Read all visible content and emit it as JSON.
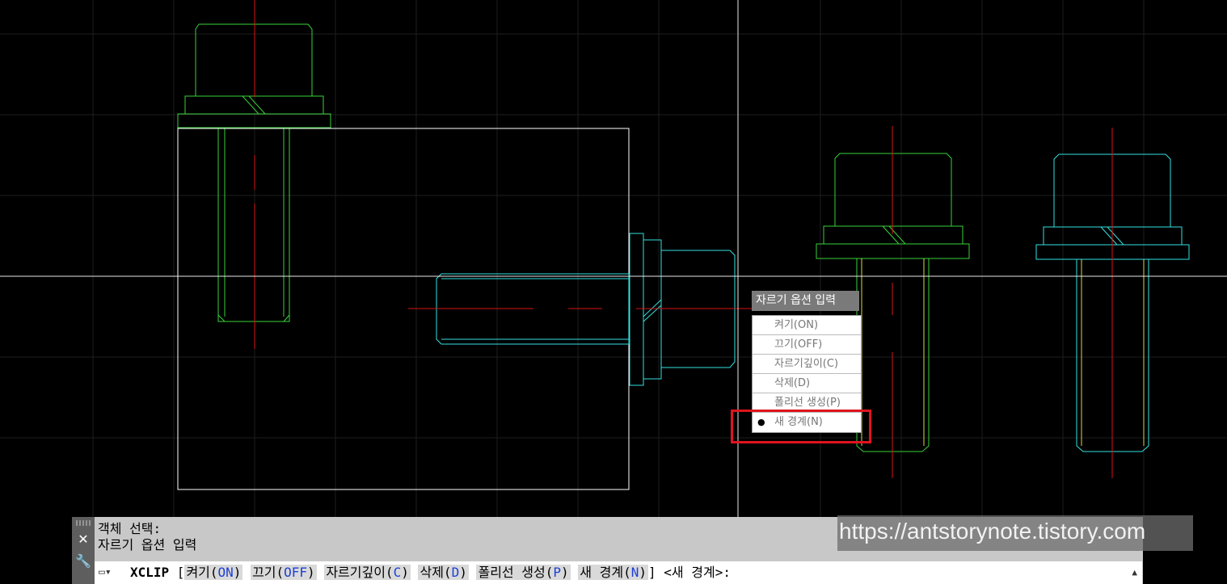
{
  "menu": {
    "title": "자르기 옵션 입력",
    "items": [
      "켜기(ON)",
      "끄기(OFF)",
      "자르기깊이(C)",
      "삭제(D)",
      "폴리선 생성(P)",
      "새 경계(N)"
    ],
    "selected_index": 5,
    "bullet": "●"
  },
  "command_history": [
    "객체 선택:",
    "자르기 옵션 입력"
  ],
  "command_line": {
    "command": "XCLIP",
    "options": [
      {
        "label": "켜기(",
        "key": "ON"
      },
      {
        "label": "끄기(",
        "key": "OFF"
      },
      {
        "label": "자르기깊이(",
        "key": "C"
      },
      {
        "label": "삭제(",
        "key": "D"
      },
      {
        "label": "폴리선 생성(",
        "key": "P"
      },
      {
        "label": "새 경계(",
        "key": "N"
      }
    ],
    "default": "<새 경계>:"
  },
  "icons": {
    "close": "close-icon",
    "customize": "wrench-icon",
    "command": "command-icon",
    "scroll": "scroll-up-icon"
  },
  "watermark": "https://antstorynote.tistory.com",
  "colors": {
    "background": "#000000",
    "green": "#39d23a",
    "cyan": "#34e0e0",
    "red": "#d81414",
    "yellow": "#d8d840",
    "white": "#ffffff",
    "highlight": "#e0141e"
  }
}
